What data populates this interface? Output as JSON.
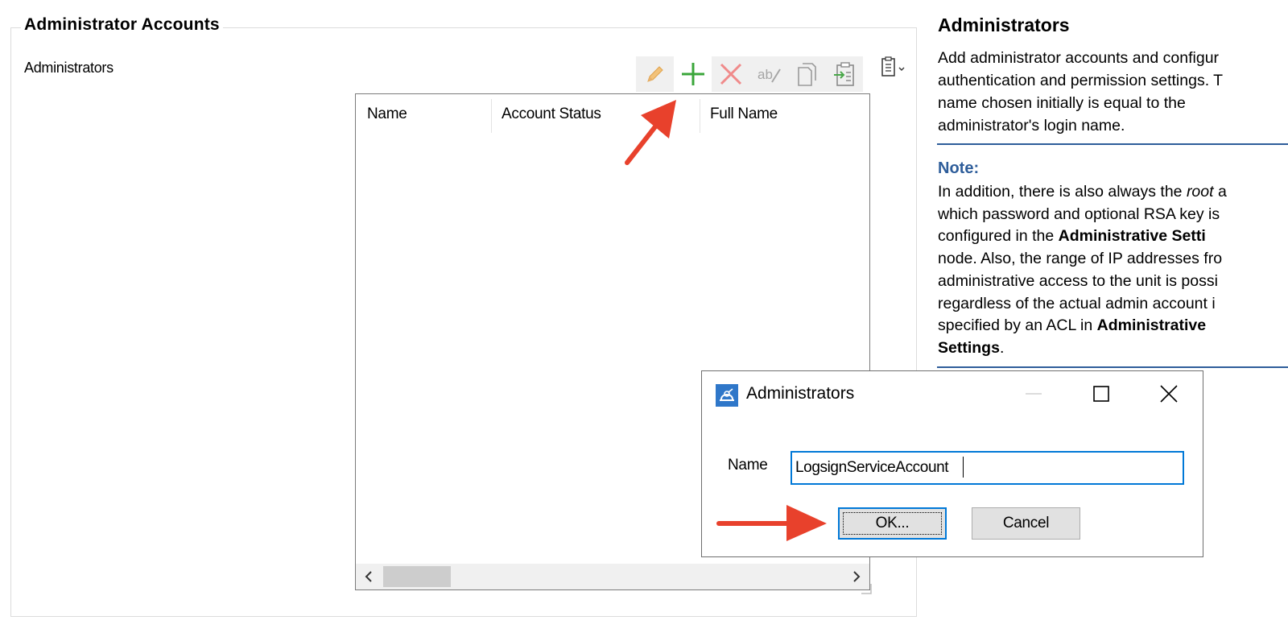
{
  "group": {
    "title": "Administrator Accounts",
    "list_label": "Administrators"
  },
  "toolbar": {
    "buttons": [
      {
        "name": "edit",
        "icon": "pencil-icon"
      },
      {
        "name": "add",
        "icon": "plus-icon"
      },
      {
        "name": "delete",
        "icon": "x-icon"
      },
      {
        "name": "rename",
        "icon": "rename-icon"
      },
      {
        "name": "copy",
        "icon": "copy-icon"
      },
      {
        "name": "paste",
        "icon": "paste-icon"
      }
    ],
    "menu_icon": "clipboard-menu-icon"
  },
  "list": {
    "columns": [
      "Name",
      "Account Status",
      "Full Name"
    ],
    "rows": []
  },
  "help": {
    "title": "Administrators",
    "intro_lines": [
      "Add administrator accounts and configur",
      "authentication and permission settings. T",
      "name chosen initially is equal to the",
      "administrator's login name."
    ],
    "note_title": "Note:",
    "note": {
      "l1a": "In addition, there is also always the ",
      "l1b": "root",
      "l1c": " a",
      "l2": "which password and optional RSA key is",
      "l3a": "configured in the ",
      "l3b": "Administrative Setti",
      "l4": "node. Also, the range of IP addresses fro",
      "l5": "administrative access to the unit is possi",
      "l6": "regardless of the actual admin account i",
      "l7a": "specified by an ACL in ",
      "l7b": "Administrative",
      "l8a": "Settings",
      "l8b": "."
    }
  },
  "dialog": {
    "title": "Administrators",
    "name_label": "Name",
    "name_value": "LogsignServiceAccount",
    "ok_label": "OK...",
    "cancel_label": "Cancel"
  },
  "colors": {
    "accent": "#0078d7",
    "help_rule": "#2e5d9a",
    "annotation_arrow": "#e8412c"
  }
}
